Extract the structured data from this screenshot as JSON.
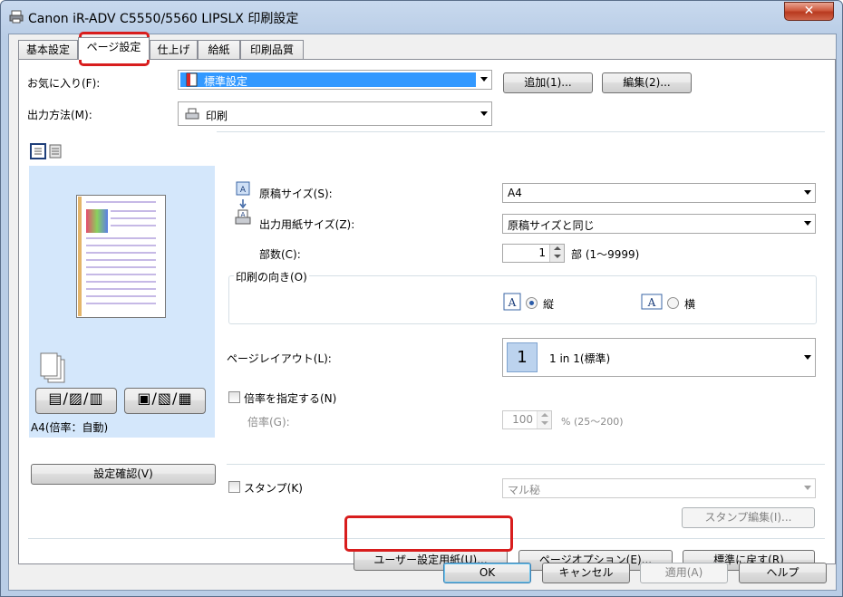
{
  "window": {
    "title": "Canon iR-ADV C5550/5560 LIPSLX 印刷設定",
    "close_label": "✕"
  },
  "tabs": [
    {
      "label": "基本設定"
    },
    {
      "label": "ページ設定"
    },
    {
      "label": "仕上げ"
    },
    {
      "label": "給紙"
    },
    {
      "label": "印刷品質"
    }
  ],
  "favorites": {
    "label": "お気に入り(F):",
    "value": "標準設定",
    "add_button": "追加(1)...",
    "edit_button": "編集(2)..."
  },
  "output_method": {
    "label": "出力方法(M):",
    "value": "印刷"
  },
  "preview": {
    "scale_text": "A4(倍率：自動)",
    "confirm_button": "設定確認(V)"
  },
  "original_size": {
    "label": "原稿サイズ(S):",
    "value": "A4"
  },
  "output_size": {
    "label": "出力用紙サイズ(Z):",
    "value": "原稿サイズと同じ"
  },
  "copies": {
    "label": "部数(C):",
    "value": "1",
    "range": "部 (1～9999)"
  },
  "orientation": {
    "group_label": "印刷の向き(O)",
    "portrait": "縦",
    "landscape": "横",
    "selected": "portrait"
  },
  "page_layout": {
    "label": "ページレイアウト(L):",
    "value": "1 in 1(標準)",
    "icon_number": "1"
  },
  "scaling": {
    "checkbox_label": "倍率を指定する(N)",
    "label": "倍率(G):",
    "value": "100",
    "range": "% (25～200)"
  },
  "stamp": {
    "checkbox_label": "スタンプ(K)",
    "value": "マル秘",
    "edit_button": "スタンプ編集(I)..."
  },
  "bottom_buttons": {
    "custom_paper": "ユーザー設定用紙(U)...",
    "page_options": "ページオプション(E)...",
    "restore_defaults": "標準に戻す(R)"
  },
  "dialog_buttons": {
    "ok": "OK",
    "cancel": "キャンセル",
    "apply": "適用(A)",
    "help": "ヘルプ"
  },
  "colors": {
    "highlight_red": "#d81d1d",
    "selection_blue": "#3399ff",
    "preview_bg": "#d4e7fb"
  }
}
